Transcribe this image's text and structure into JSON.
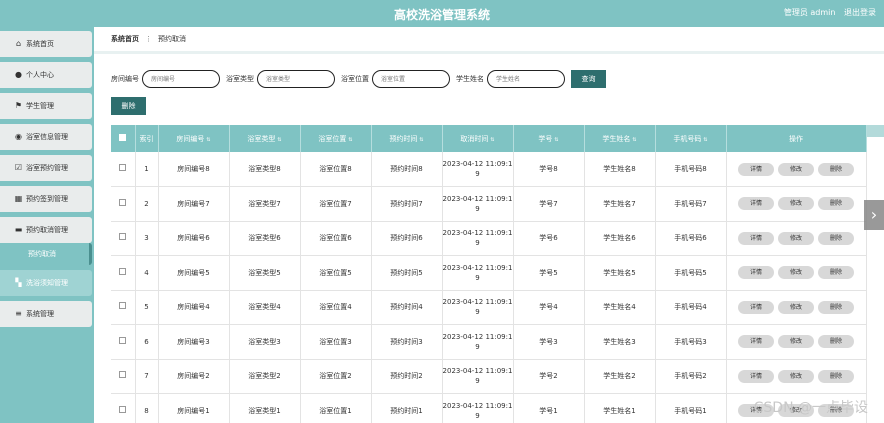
{
  "header": {
    "title": "高校洗浴管理系统",
    "user": "管理员 admin",
    "logout": "退出登录"
  },
  "sidebar": {
    "items": [
      {
        "label": "系统首页",
        "icon": "home-icon"
      },
      {
        "label": "个人中心",
        "icon": "user-icon"
      },
      {
        "label": "学生管理",
        "icon": "flag-icon"
      },
      {
        "label": "浴室信息管理",
        "icon": "pin-icon"
      },
      {
        "label": "浴室预约管理",
        "icon": "check-icon"
      },
      {
        "label": "预约签到管理",
        "icon": "grid-icon"
      },
      {
        "label": "预约取消管理",
        "icon": "chat-icon"
      }
    ],
    "sub_item": "预约取消",
    "after": [
      {
        "label": "洗浴须知管理",
        "icon": "apps-icon"
      },
      {
        "label": "系统管理",
        "icon": "menu-icon"
      }
    ]
  },
  "breadcrumb": {
    "home": "系统首页",
    "current": "预约取消"
  },
  "search": {
    "room_label": "房间编号",
    "room_placeholder": "房间编号",
    "type_label": "浴室类型",
    "type_placeholder": "浴室类型",
    "pos_label": "浴室位置",
    "pos_placeholder": "浴室位置",
    "name_label": "学生姓名",
    "name_placeholder": "学生姓名",
    "query_button": "查询"
  },
  "delete_button": "删除",
  "table": {
    "headers": [
      "索引",
      "房间编号",
      "浴室类型",
      "浴室位置",
      "预约时间",
      "取消时间",
      "学号",
      "学生姓名",
      "手机号码",
      "操作"
    ],
    "actions": {
      "detail": "详情",
      "edit": "修改",
      "delete": "删除"
    },
    "rows": [
      {
        "idx": "1",
        "room": "房间编号8",
        "type": "浴室类型8",
        "pos": "浴室位置8",
        "time": "预约时间8",
        "cancel1": "2023-04-12 11:09:1",
        "cancel2": "9",
        "sid": "学号8",
        "name": "学生姓名8",
        "phone": "手机号码8"
      },
      {
        "idx": "2",
        "room": "房间编号7",
        "type": "浴室类型7",
        "pos": "浴室位置7",
        "time": "预约时间7",
        "cancel1": "2023-04-12 11:09:1",
        "cancel2": "9",
        "sid": "学号7",
        "name": "学生姓名7",
        "phone": "手机号码7"
      },
      {
        "idx": "3",
        "room": "房间编号6",
        "type": "浴室类型6",
        "pos": "浴室位置6",
        "time": "预约时间6",
        "cancel1": "2023-04-12 11:09:1",
        "cancel2": "9",
        "sid": "学号6",
        "name": "学生姓名6",
        "phone": "手机号码6"
      },
      {
        "idx": "4",
        "room": "房间编号5",
        "type": "浴室类型5",
        "pos": "浴室位置5",
        "time": "预约时间5",
        "cancel1": "2023-04-12 11:09:1",
        "cancel2": "9",
        "sid": "学号5",
        "name": "学生姓名5",
        "phone": "手机号码5"
      },
      {
        "idx": "5",
        "room": "房间编号4",
        "type": "浴室类型4",
        "pos": "浴室位置4",
        "time": "预约时间4",
        "cancel1": "2023-04-12 11:09:1",
        "cancel2": "9",
        "sid": "学号4",
        "name": "学生姓名4",
        "phone": "手机号码4"
      },
      {
        "idx": "6",
        "room": "房间编号3",
        "type": "浴室类型3",
        "pos": "浴室位置3",
        "time": "预约时间3",
        "cancel1": "2023-04-12 11:09:1",
        "cancel2": "9",
        "sid": "学号3",
        "name": "学生姓名3",
        "phone": "手机号码3"
      },
      {
        "idx": "7",
        "room": "房间编号2",
        "type": "浴室类型2",
        "pos": "浴室位置2",
        "time": "预约时间2",
        "cancel1": "2023-04-12 11:09:1",
        "cancel2": "9",
        "sid": "学号2",
        "name": "学生姓名2",
        "phone": "手机号码2"
      },
      {
        "idx": "8",
        "room": "房间编号1",
        "type": "浴室类型1",
        "pos": "浴室位置1",
        "time": "预约时间1",
        "cancel1": "2023-04-12 11:09:1",
        "cancel2": "9",
        "sid": "学号1",
        "name": "学生姓名1",
        "phone": "手机号码1"
      }
    ]
  },
  "watermark": "CSDN @一点毕设"
}
